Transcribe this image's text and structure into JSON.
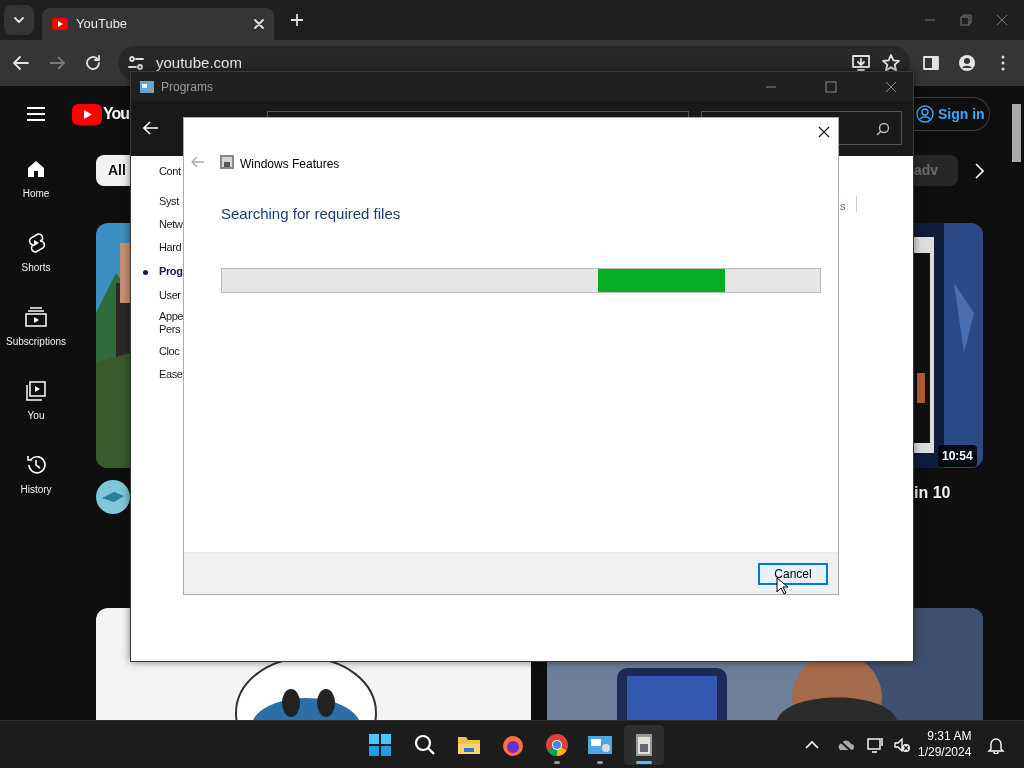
{
  "browser": {
    "tab": {
      "title": "YouTube"
    },
    "address": "youtube.com"
  },
  "youtube": {
    "logo_text": "You",
    "sign_in": "Sign in",
    "chips": [
      {
        "label": "All",
        "selected": true
      },
      {
        "label": "adv",
        "selected": false
      }
    ],
    "sidebar": [
      {
        "label": "Home",
        "kind": "home"
      },
      {
        "label": "Shorts",
        "kind": "shorts"
      },
      {
        "label": "Subscriptions",
        "kind": "subscriptions"
      },
      {
        "label": "You",
        "kind": "you"
      },
      {
        "label": "History",
        "kind": "history"
      }
    ],
    "right_video": {
      "duration": "10:54",
      "title": "in 10"
    }
  },
  "programs_window": {
    "title": "Programs",
    "nav": [
      {
        "lines": [
          "Cont"
        ],
        "selected": false
      },
      {
        "lines": [
          "Syst"
        ],
        "selected": false
      },
      {
        "lines": [
          "Netw"
        ],
        "selected": false
      },
      {
        "lines": [
          "Hard"
        ],
        "selected": false
      },
      {
        "lines": [
          "Prog"
        ],
        "selected": true
      },
      {
        "lines": [
          "User"
        ],
        "selected": false
      },
      {
        "lines": [
          "Appe",
          "Pers"
        ],
        "selected": false
      },
      {
        "lines": [
          "Cloc"
        ],
        "selected": false
      },
      {
        "lines": [
          "Ease"
        ],
        "selected": false
      }
    ],
    "right_text": "s"
  },
  "dialog": {
    "title": "Windows Features",
    "heading": "Searching for required files",
    "progress": {
      "indeterminate": true
    },
    "buttons": [
      {
        "label": "Cancel",
        "focused": true
      }
    ]
  },
  "taskbar": {
    "apps": [
      {
        "kind": "start",
        "running": false,
        "active": false
      },
      {
        "kind": "search",
        "running": false,
        "active": false
      },
      {
        "kind": "files",
        "running": false,
        "active": false
      },
      {
        "kind": "firefox",
        "running": false,
        "active": false
      },
      {
        "kind": "chrome",
        "running": true,
        "active": false
      },
      {
        "kind": "control-panel",
        "running": true,
        "active": false
      },
      {
        "kind": "features",
        "running": true,
        "active": true
      }
    ],
    "clock": {
      "time": "9:31 AM",
      "date": "1/29/2024"
    }
  }
}
